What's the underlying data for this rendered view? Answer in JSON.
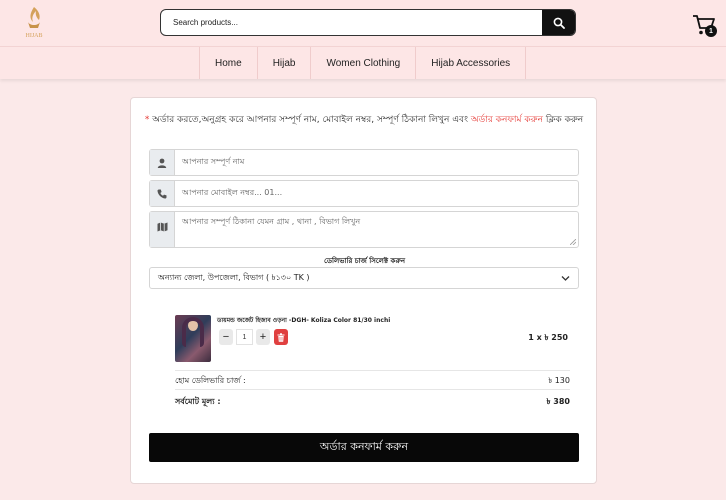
{
  "header": {
    "logo_text": "HIJAB",
    "search_placeholder": "Search products...",
    "cart_count": "1"
  },
  "nav": {
    "items": [
      "Home",
      "Hijab",
      "Women Clothing",
      "Hijab Accessories"
    ]
  },
  "order_form": {
    "notice_star": "*",
    "notice_text": " অর্ডার করতে,অনুগ্রহ করে আপনার সম্পূর্ণ নাম, মোবাইল নম্বর, সম্পূর্ণ ঠিকানা লিখুন এবং ",
    "notice_link": "অর্ডার কনফার্ম করুন",
    "notice_suffix": " ক্লিক করুন",
    "name_placeholder": "আপনার সম্পূর্ণ নাম",
    "phone_placeholder": "আপনার মোবাইল নম্বর... 01...",
    "address_placeholder": "আপনার সম্পূর্ণ ঠিকানা যেমন গ্রাম , থানা , বিভাগ লিখুন",
    "delivery_label": "ডেলিভারি চার্জ সিলেক্ট করুন",
    "delivery_selected": "অন্যান্য জেলা, উপজেলা, বিভাগ ( ৳১৩০ TK )",
    "product": {
      "name": "ডায়মন্ড জর্জেট হিজাব ওড়না -DGH- Koliza Color 81/30 inchi",
      "qty": "1",
      "line_price": "1 x ৳ 250"
    },
    "shipping_label": "হোম ডেলিভারি চার্জ :",
    "shipping_value": "৳ 130",
    "total_label": "সর্বমোট মূল্য :",
    "total_value": "৳ 380",
    "confirm_label": "অর্ডার কনফার্ম করুন"
  },
  "colors": {
    "header_bg": "#fde6e6",
    "page_bg": "#fbe9e9",
    "accent_red": "#e53935",
    "button_dark": "#080808"
  }
}
